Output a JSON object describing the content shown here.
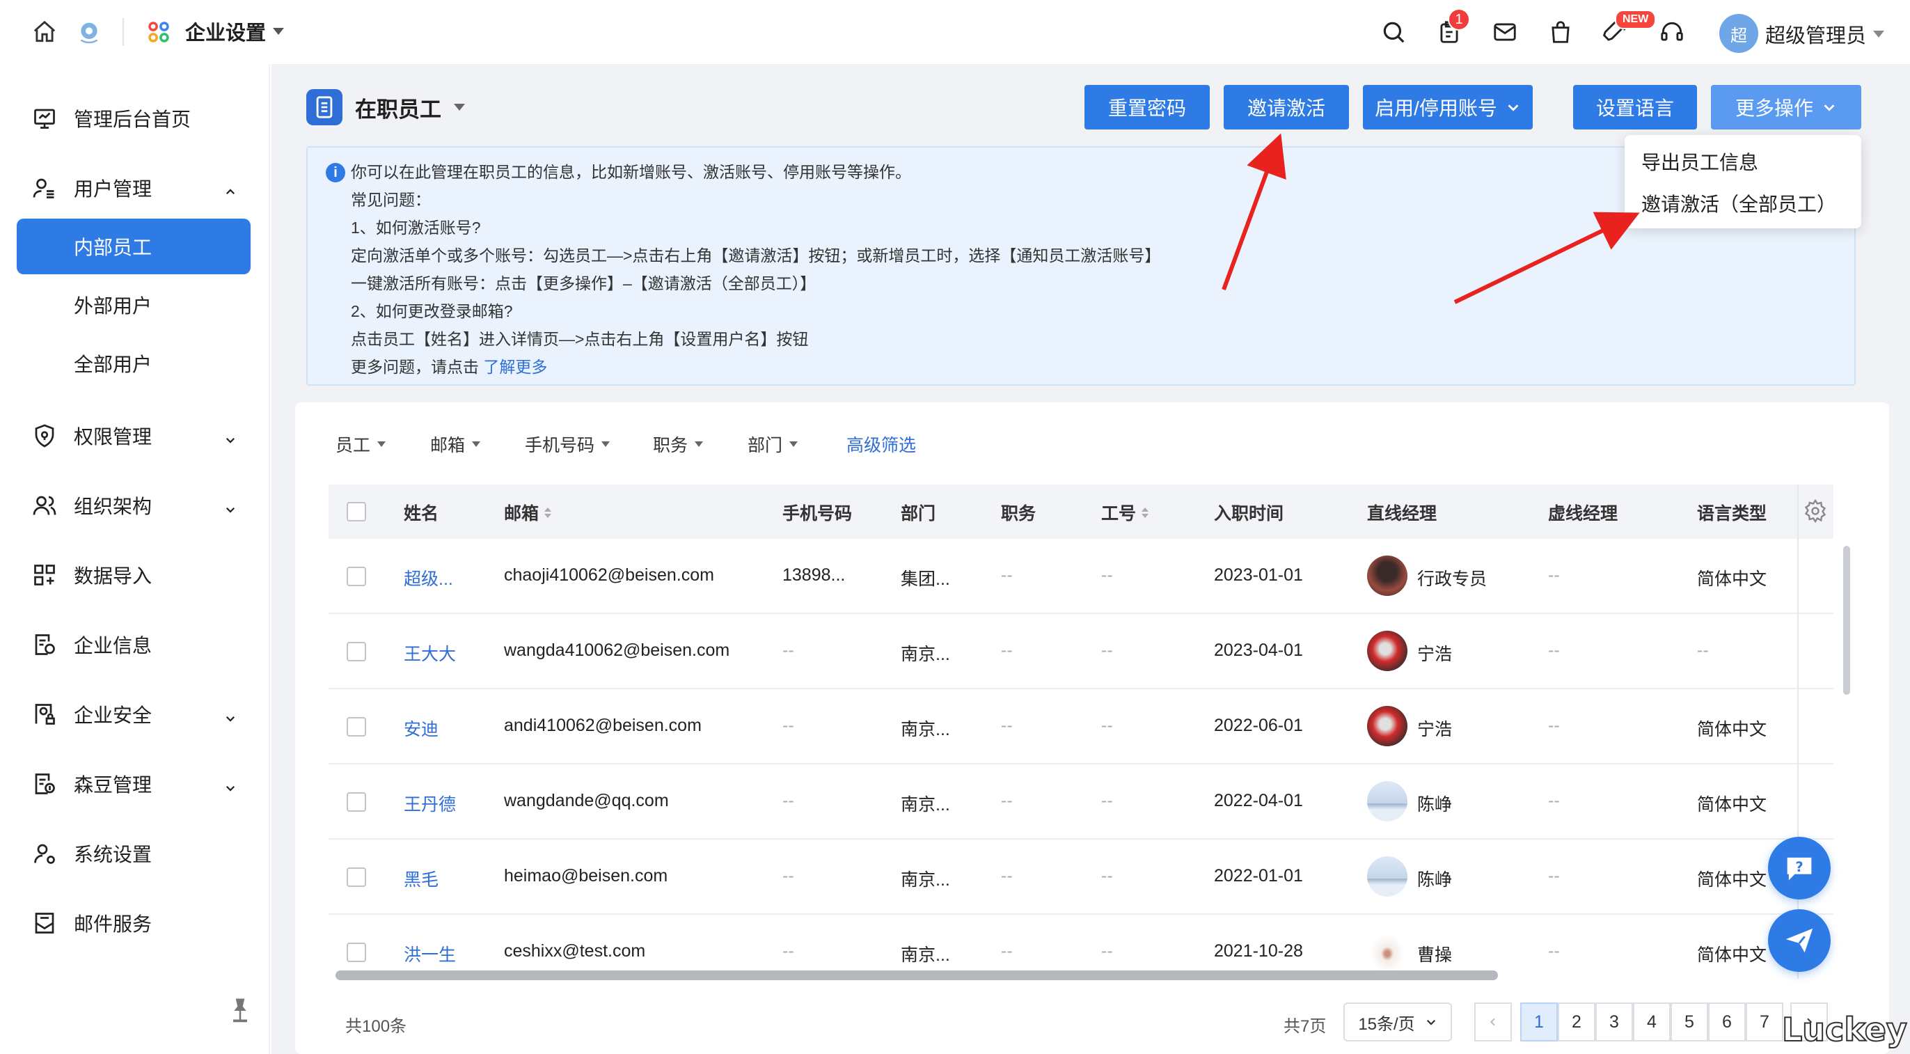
{
  "topbar": {
    "app_title": "企业设置",
    "notification_count": "1",
    "new_badge": "NEW",
    "avatar_text": "超",
    "user_name": "超级管理员"
  },
  "sidebar": {
    "items": [
      {
        "label": "管理后台首页",
        "icon": "monitor-icon"
      },
      {
        "label": "用户管理",
        "icon": "user-list-icon",
        "expanded": true
      },
      {
        "label": "内部员工",
        "sub": true,
        "active": true
      },
      {
        "label": "外部用户",
        "sub": true
      },
      {
        "label": "全部用户",
        "sub": true
      },
      {
        "label": "权限管理",
        "icon": "shield-icon"
      },
      {
        "label": "组织架构",
        "icon": "group-icon"
      },
      {
        "label": "数据导入",
        "icon": "import-icon"
      },
      {
        "label": "企业信息",
        "icon": "company-info-icon"
      },
      {
        "label": "企业安全",
        "icon": "security-icon"
      },
      {
        "label": "森豆管理",
        "icon": "bean-icon"
      },
      {
        "label": "系统设置",
        "icon": "settings-user-icon"
      },
      {
        "label": "邮件服务",
        "icon": "mail-service-icon"
      }
    ]
  },
  "page": {
    "title": "在职员工"
  },
  "actions": {
    "reset_password": "重置密码",
    "invite_activate": "邀请激活",
    "enable_disable": "启用/停用账号",
    "set_language": "设置语言",
    "more_actions": "更多操作"
  },
  "more_menu": {
    "items": [
      "导出员工信息",
      "邀请激活（全部员工）"
    ]
  },
  "info": {
    "lines": [
      "你可以在此管理在职员工的信息，比如新增账号、激活账号、停用账号等操作。",
      "常见问题：",
      "1、如何激活账号?",
      "定向激活单个或多个账号：勾选员工—>点击右上角【邀请激活】按钮；或新增员工时，选择【通知员工激活账号】",
      "一键激活所有账号：点击【更多操作】–【邀请激活（全部员工）】",
      "2、如何更改登录邮箱?",
      "点击员工【姓名】进入详情页—>点击右上角【设置用户名】按钮"
    ],
    "more_prefix": "更多问题，请点击",
    "more_link": "了解更多"
  },
  "filters": [
    "员工",
    "邮箱",
    "手机号码",
    "职务",
    "部门"
  ],
  "advanced_filter": "高级筛选",
  "table": {
    "headers": [
      "姓名",
      "邮箱",
      "手机号码",
      "部门",
      "职务",
      "工号",
      "入职时间",
      "直线经理",
      "虚线经理",
      "语言类型"
    ],
    "rows": [
      {
        "name": "超级...",
        "email": "chaoji410062@beisen.com",
        "phone": "13898...",
        "dept": "集团...",
        "title": "--",
        "empno": "--",
        "join": "2023-01-01",
        "manager": "行政专员",
        "dotted": "--",
        "lang": "简体中文"
      },
      {
        "name": "王大大",
        "email": "wangda410062@beisen.com",
        "phone": "--",
        "dept": "南京...",
        "title": "--",
        "empno": "--",
        "join": "2023-04-01",
        "manager": "宁浩",
        "dotted": "--",
        "lang": "--"
      },
      {
        "name": "安迪",
        "email": "andi410062@beisen.com",
        "phone": "--",
        "dept": "南京...",
        "title": "--",
        "empno": "--",
        "join": "2022-06-01",
        "manager": "宁浩",
        "dotted": "--",
        "lang": "简体中文"
      },
      {
        "name": "王丹德",
        "email": "wangdande@qq.com",
        "phone": "--",
        "dept": "南京...",
        "title": "--",
        "empno": "--",
        "join": "2022-04-01",
        "manager": "陈峥",
        "dotted": "--",
        "lang": "简体中文"
      },
      {
        "name": "黑毛",
        "email": "heimao@beisen.com",
        "phone": "--",
        "dept": "南京...",
        "title": "--",
        "empno": "--",
        "join": "2022-01-01",
        "manager": "陈峥",
        "dotted": "--",
        "lang": "简体中文"
      },
      {
        "name": "洪一生",
        "email": "ceshixx@test.com",
        "phone": "--",
        "dept": "南京...",
        "title": "--",
        "empno": "--",
        "join": "2021-10-28",
        "manager": "曹操",
        "dotted": "--",
        "lang": "简体中文"
      }
    ]
  },
  "pagination": {
    "total": "共100条",
    "pages_total": "共7页",
    "page_size": "15条/页",
    "pages": [
      "1",
      "2",
      "3",
      "4",
      "5",
      "6",
      "7"
    ],
    "current": "1"
  },
  "corner_text": "Luckey",
  "colors": {
    "primary": "#2f7be6",
    "link": "#2f6ed6",
    "info_bg": "#eaf3fd",
    "badge_red": "#f23b3b",
    "arrow_red": "#e8231f"
  }
}
